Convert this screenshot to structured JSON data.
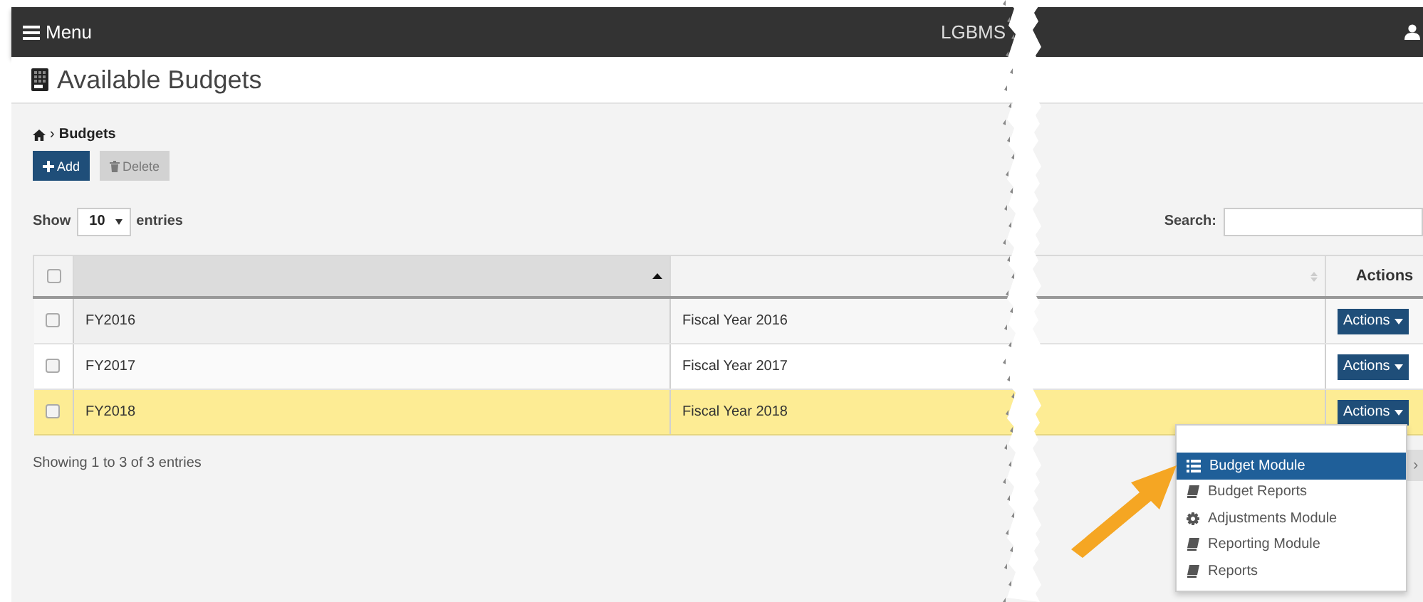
{
  "navbar": {
    "menu_label": "Menu",
    "brand": "LGBMS"
  },
  "page_title": "Available Budgets",
  "breadcrumb": {
    "separator": "›",
    "current": "Budgets"
  },
  "toolbar": [
    {
      "label": "Add",
      "kind": "add",
      "disabled": false
    },
    {
      "label": "Delete",
      "kind": "delete",
      "disabled": true
    }
  ],
  "length_menu": {
    "prefix": "Show",
    "value": "10",
    "suffix": "entries"
  },
  "search": {
    "label": "Search:"
  },
  "table": {
    "columns": [
      {
        "kind": "checkbox",
        "checked": false
      },
      {
        "kind": "sortable",
        "sorted": true
      },
      {
        "kind": "sortable",
        "sorted": false
      },
      {
        "kind": "text",
        "label": "Actions"
      }
    ],
    "rows": [
      {
        "checked": false,
        "selected": false,
        "column_2": "FY2016",
        "column_3": "Fiscal Year 2016",
        "action": "Actions"
      },
      {
        "checked": false,
        "selected": false,
        "column_2": "FY2017",
        "column_3": "Fiscal Year 2017",
        "action": "Actions"
      },
      {
        "checked": false,
        "selected": true,
        "column_2": "FY2018",
        "column_3": "Fiscal Year 2018",
        "action": "Actions"
      }
    ]
  },
  "info": "Showing 1 to 3 of 3 entries",
  "pagination": {
    "next": "›"
  },
  "action_menu": {
    "items": [
      {
        "label": "Budget Module",
        "kind": "list",
        "selected": true
      },
      {
        "label": "Budget Reports",
        "kind": "book",
        "selected": false
      },
      {
        "label": "Adjustments Module",
        "kind": "gear",
        "selected": false
      },
      {
        "label": "Reporting Module",
        "kind": "book",
        "selected": false
      },
      {
        "label": "Reports",
        "kind": "book",
        "selected": false
      }
    ]
  }
}
